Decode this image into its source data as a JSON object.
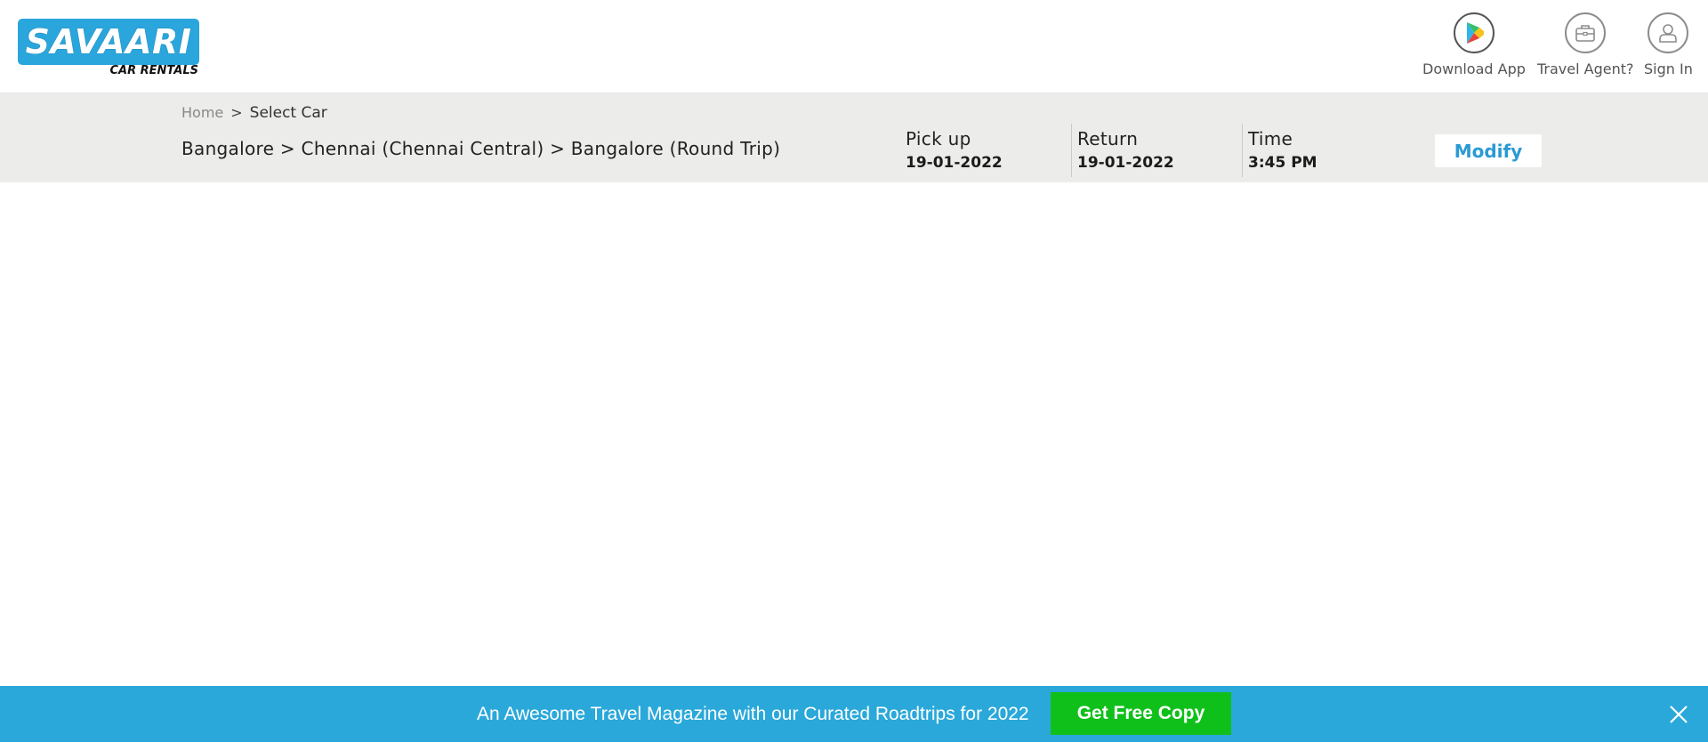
{
  "header": {
    "logo": {
      "main": "SAVAARI",
      "sub": "CAR RENTALS"
    },
    "nav": [
      {
        "label": "Download App",
        "icon": "play-store-icon"
      },
      {
        "label": "Travel Agent?",
        "icon": "briefcase-icon"
      },
      {
        "label": "Sign In",
        "icon": "user-icon"
      }
    ]
  },
  "breadcrumb": {
    "home": "Home",
    "separator": ">",
    "current": "Select Car"
  },
  "trip": {
    "route": "Bangalore > Chennai (Chennai Central) > Bangalore (Round Trip)",
    "pickup_label": "Pick up",
    "pickup_value": "19-01-2022",
    "return_label": "Return",
    "return_value": "19-01-2022",
    "time_label": "Time",
    "time_value": "3:45 PM",
    "modify_label": "Modify"
  },
  "promo": {
    "text": "An Awesome Travel Magazine with our Curated Roadtrips for 2022",
    "button_label": "Get Free Copy",
    "close_icon": "close-icon"
  },
  "colors": {
    "brand_blue": "#2aa6dc",
    "strip_bg": "#ececea",
    "promo_bg": "#2aa8da",
    "cta_green": "#10c01a",
    "modify_text": "#2a9ad4"
  }
}
